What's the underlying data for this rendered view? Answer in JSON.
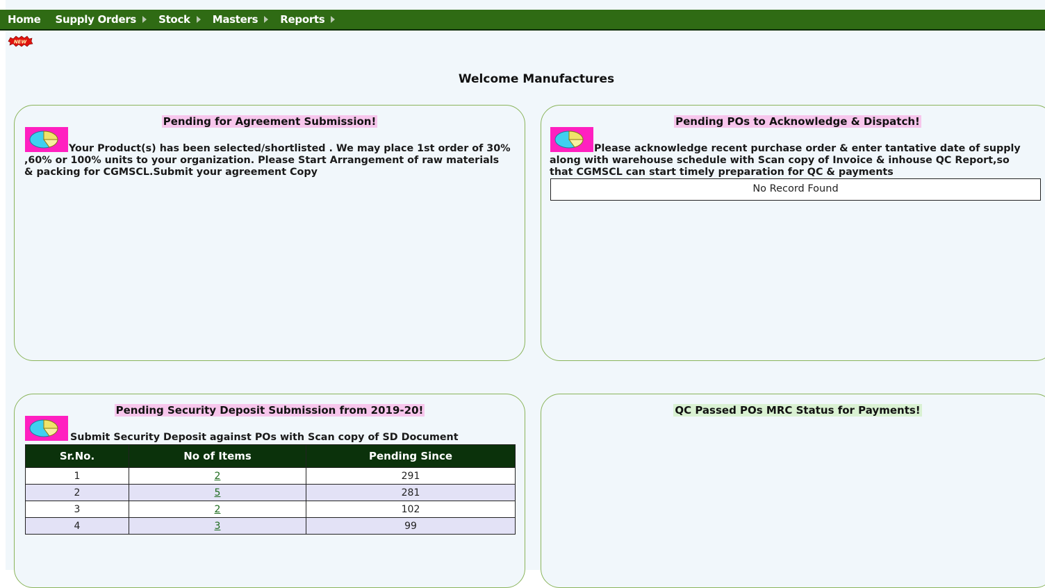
{
  "nav": {
    "items": [
      {
        "label": "Home",
        "has_arrow": false
      },
      {
        "label": "Supply Orders",
        "has_arrow": true
      },
      {
        "label": "Stock",
        "has_arrow": true
      },
      {
        "label": "Masters",
        "has_arrow": true
      },
      {
        "label": "Reports",
        "has_arrow": true
      }
    ]
  },
  "new_badge": "NEW",
  "welcome": "Welcome Manufactures",
  "panels": {
    "agreement": {
      "title": "Pending for Agreement Submission!",
      "text": "Your Product(s) has been selected/shortlisted . We may place 1st order of 30% ,60% or 100% units to your organization. Please Start Arrangement of raw materials & packing for CGMSCL.Submit your agreement Copy"
    },
    "po_ack": {
      "title": "Pending POs to Acknowledge & Dispatch!",
      "text": "Please acknowledge recent purchase order & enter tantative date of supply along with warehouse schedule with Scan copy of Invoice & inhouse QC Report,so that CGMSCL can start timely preparation for QC & payments",
      "empty_message": "No Record Found"
    },
    "security_deposit": {
      "title": "Pending Security Deposit Submission from 2019-20!",
      "text": "Submit Security Deposit against POs with Scan copy of SD Document",
      "columns": [
        "Sr.No.",
        "No of Items",
        "Pending Since"
      ],
      "rows": [
        {
          "sr": "1",
          "items": "2",
          "pending": "291"
        },
        {
          "sr": "2",
          "items": "5",
          "pending": "281"
        },
        {
          "sr": "3",
          "items": "2",
          "pending": "102"
        },
        {
          "sr": "4",
          "items": "3",
          "pending": "99"
        }
      ]
    },
    "qc_passed": {
      "title": "QC Passed POs MRC Status for Payments!"
    }
  },
  "colors": {
    "nav_bg": "#2f6b14",
    "panel_border": "#8ab45a",
    "title_highlight_pink": "#f7c6ec",
    "title_highlight_green": "#d9f1d2",
    "table_header_bg": "#0b320b",
    "table_alt_row": "#e3e2f6",
    "icon_bg": "#ff20c0"
  },
  "icons": [
    "pie-chart-icon",
    "new-badge-icon",
    "menu-arrow-icon"
  ]
}
